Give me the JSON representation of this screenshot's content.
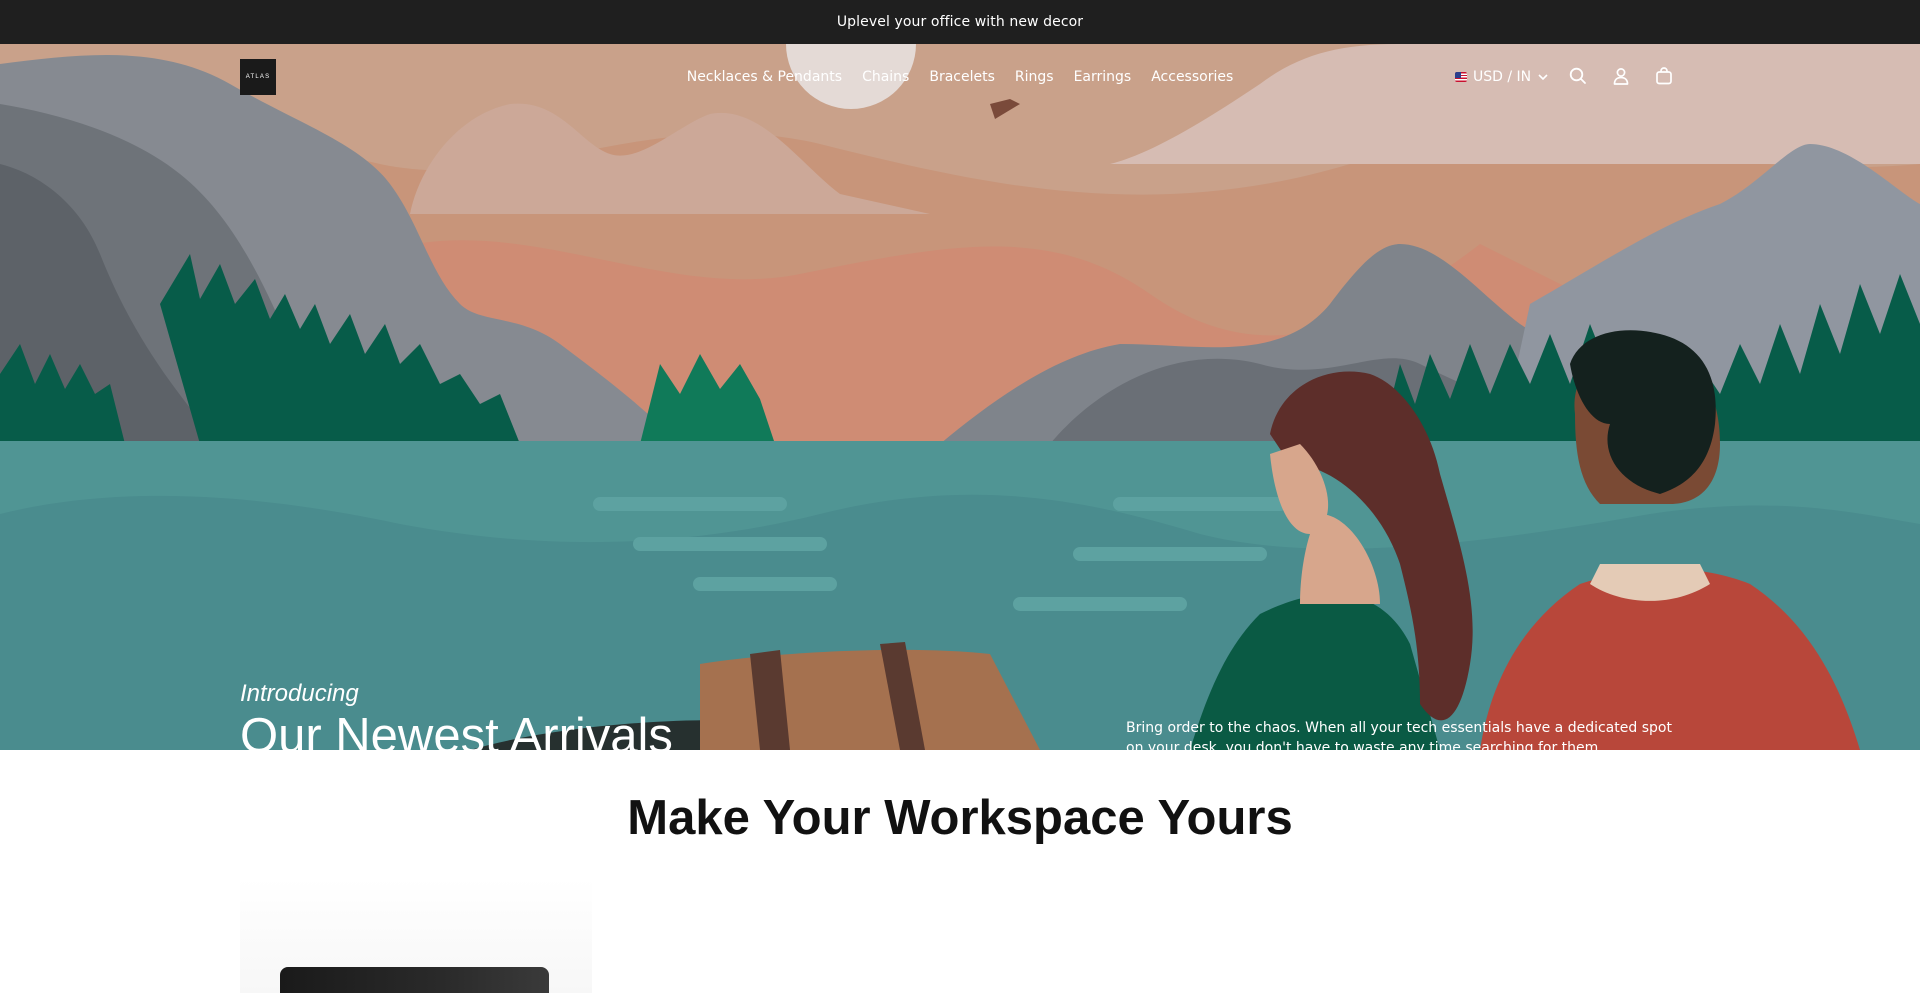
{
  "announcement": {
    "text": "Uplevel your office with new decor"
  },
  "header": {
    "logo_text": "ATLAS",
    "nav": [
      {
        "label": "Necklaces & Pendants"
      },
      {
        "label": "Chains"
      },
      {
        "label": "Bracelets"
      },
      {
        "label": "Rings"
      },
      {
        "label": "Earrings"
      },
      {
        "label": "Accessories"
      }
    ],
    "currency": {
      "label": "USD / IN",
      "flag_icon": "us-flag-icon"
    },
    "icons": [
      "search-icon",
      "account-icon",
      "cart-icon"
    ]
  },
  "hero": {
    "eyebrow": "Introducing",
    "title": "Our Newest Arrivals",
    "description": "Bring order to the chaos. When all your tech essentials have a dedicated spot on your desk, you don't have to waste any time searching for them."
  },
  "section": {
    "title": "Make Your Workspace Yours"
  },
  "colors": {
    "announcement_bg": "#1f1f1f",
    "sky": "#c8957a",
    "water": "#4f9193",
    "forest": "#075c49",
    "mountain": "#858a91"
  }
}
